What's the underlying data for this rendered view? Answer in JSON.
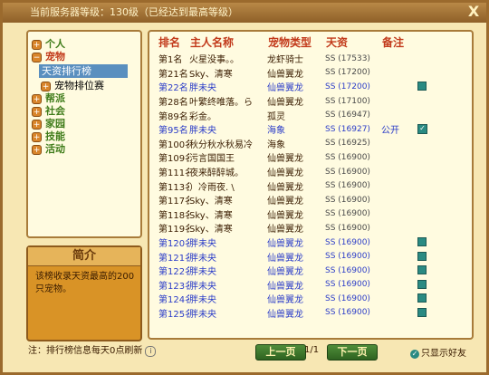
{
  "window": {
    "title": "当前服务器等级：130级（已经达到最高等级）",
    "close_label": "X"
  },
  "tree": [
    {
      "label": "个人",
      "icon": "plus-icon",
      "style": "cat"
    },
    {
      "label": "宠物",
      "icon": "minus-icon",
      "style": "cat-red"
    },
    {
      "label": "天资排行榜",
      "icon": "",
      "style": "sel"
    },
    {
      "label": "宠物排位赛",
      "icon": "plus-icon",
      "style": "sub"
    },
    {
      "label": "帮派",
      "icon": "plus-icon",
      "style": "cat"
    },
    {
      "label": "社会",
      "icon": "plus-icon",
      "style": "cat"
    },
    {
      "label": "家园",
      "icon": "plus-icon",
      "style": "cat"
    },
    {
      "label": "技能",
      "icon": "plus-icon",
      "style": "cat"
    },
    {
      "label": "活动",
      "icon": "plus-icon",
      "style": "cat"
    }
  ],
  "intro": {
    "title": "简介",
    "text": "该榜收录天资最高的200只宠物。"
  },
  "table": {
    "headers": [
      "排名",
      "主人名称",
      "宠物类型",
      "天资",
      "备注"
    ],
    "rows": [
      {
        "rank": "第1名",
        "owner": "火星没事。。",
        "pet": "龙虾骑士",
        "aptitude": "SS (17533)",
        "note": "",
        "check": "",
        "blue": false
      },
      {
        "rank": "第21名",
        "owner": "Sky、清寒",
        "pet": "仙兽翼龙",
        "aptitude": "SS (17200)",
        "note": "",
        "check": "",
        "blue": false
      },
      {
        "rank": "第22名",
        "owner": "胖未央",
        "pet": "仙兽翼龙",
        "aptitude": "SS (17200)",
        "note": "",
        "check": "box",
        "blue": true
      },
      {
        "rank": "第28名",
        "owner": "叶繁终唯落。ら",
        "pet": "仙兽翼龙",
        "aptitude": "SS (17100)",
        "note": "",
        "check": "",
        "blue": false
      },
      {
        "rank": "第89名",
        "owner": "彩金。",
        "pet": "孤灵",
        "aptitude": "SS (16947)",
        "note": "",
        "check": "",
        "blue": false
      },
      {
        "rank": "第95名",
        "owner": "胖未央",
        "pet": "海象",
        "aptitude": "SS (16927)",
        "note": "公开",
        "check": "checked",
        "blue": true
      },
      {
        "rank": "第100名",
        "owner": "秋分秋水秋易冷",
        "pet": "海象",
        "aptitude": "SS (16925)",
        "note": "",
        "check": "",
        "blue": false
      },
      {
        "rank": "第109名",
        "owner": "污言国国王",
        "pet": "仙兽翼龙",
        "aptitude": "SS (16900)",
        "note": "",
        "check": "",
        "blue": false
      },
      {
        "rank": "第111名",
        "owner": "夜来醉醉城。",
        "pet": "仙兽翼龙",
        "aptitude": "SS (16900)",
        "note": "",
        "check": "",
        "blue": false
      },
      {
        "rank": "第113名",
        "owner": "）冷雨夜. \\",
        "pet": "仙兽翼龙",
        "aptitude": "SS (16900)",
        "note": "",
        "check": "",
        "blue": false
      },
      {
        "rank": "第117名",
        "owner": "Sky、清寒",
        "pet": "仙兽翼龙",
        "aptitude": "SS (16900)",
        "note": "",
        "check": "",
        "blue": false
      },
      {
        "rank": "第118名",
        "owner": "Sky、清寒",
        "pet": "仙兽翼龙",
        "aptitude": "SS (16900)",
        "note": "",
        "check": "",
        "blue": false
      },
      {
        "rank": "第119名",
        "owner": "Sky、清寒",
        "pet": "仙兽翼龙",
        "aptitude": "SS (16900)",
        "note": "",
        "check": "",
        "blue": false
      },
      {
        "rank": "第120名",
        "owner": "胖未央",
        "pet": "仙兽翼龙",
        "aptitude": "SS (16900)",
        "note": "",
        "check": "box",
        "blue": true
      },
      {
        "rank": "第121名",
        "owner": "胖未央",
        "pet": "仙兽翼龙",
        "aptitude": "SS (16900)",
        "note": "",
        "check": "box",
        "blue": true
      },
      {
        "rank": "第122名",
        "owner": "胖未央",
        "pet": "仙兽翼龙",
        "aptitude": "SS (16900)",
        "note": "",
        "check": "box",
        "blue": true
      },
      {
        "rank": "第123名",
        "owner": "胖未央",
        "pet": "仙兽翼龙",
        "aptitude": "SS (16900)",
        "note": "",
        "check": "box",
        "blue": true
      },
      {
        "rank": "第124名",
        "owner": "胖未央",
        "pet": "仙兽翼龙",
        "aptitude": "SS (16900)",
        "note": "",
        "check": "box",
        "blue": true
      },
      {
        "rank": "第125名",
        "owner": "胖未央",
        "pet": "仙兽翼龙",
        "aptitude": "SS (16900)",
        "note": "",
        "check": "box",
        "blue": true
      }
    ]
  },
  "footer": {
    "note": "注：排行榜信息每天0点刷新",
    "prev_label": "上一页",
    "next_label": "下一页",
    "page": "1/1",
    "friends_label": "只显示好友"
  },
  "colors": {
    "frame": "#9b6a2d",
    "panel": "#fffbe0",
    "header_text": "#c23a1b",
    "highlight_text": "#2b3cc8",
    "selected_bg": "#5a8fbf"
  }
}
